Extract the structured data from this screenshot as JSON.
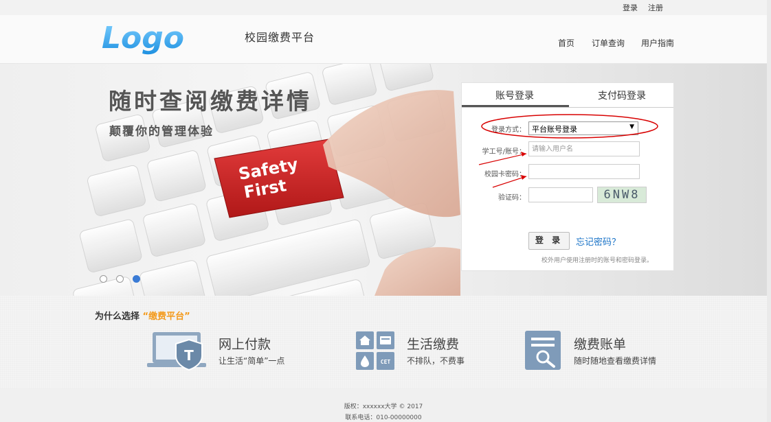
{
  "topbar": {
    "login": "登录",
    "register": "注册"
  },
  "header": {
    "logo_text": "Logo",
    "site_title": "校园缴费平台"
  },
  "nav": {
    "items": [
      "首页",
      "订单查询",
      "用户指南"
    ]
  },
  "banner": {
    "title": "随时查阅缴费详情",
    "subtitle": "颠覆你的管理体验",
    "key_text_line1": "Safety",
    "key_text_line2": "First",
    "slides_total": 3,
    "active_slide": 3
  },
  "login": {
    "tabs": [
      "账号登录",
      "支付码登录"
    ],
    "active_tab": 0,
    "method_label": "登录方式：",
    "method_value": "平台账号登录",
    "user_label": "学工号/账号：",
    "user_placeholder": "请输入用户名",
    "password_label": "校园卡密码：",
    "password_value": "",
    "captcha_label": "验证码：",
    "captcha_value": "",
    "captcha_image_text": "6NW8",
    "submit_label": "登 录",
    "forgot_label": "忘记密码？",
    "hint": "校外用户使用注册时的账号和密码登录。"
  },
  "features": {
    "heading_prefix": "为什么选择",
    "heading_highlight": "“缴费平台”",
    "items": [
      {
        "title": "网上付款",
        "desc": "让生活“简单”一点",
        "icon": "laptop-shield-icon"
      },
      {
        "title": "生活缴费",
        "desc": "不排队，不费事",
        "icon": "utilities-grid-icon"
      },
      {
        "title": "缴费账单",
        "desc": "随时随地查看缴费详情",
        "icon": "bill-search-icon"
      }
    ]
  },
  "footer": {
    "copyright": "版权：xxxxxx大学 © 2017",
    "phone": "联系电话：010-00000000"
  },
  "colors": {
    "accent": "#3a7bd5",
    "highlight": "#f39a1c",
    "annotation": "#d80000",
    "key_red": "#d42a2a"
  }
}
